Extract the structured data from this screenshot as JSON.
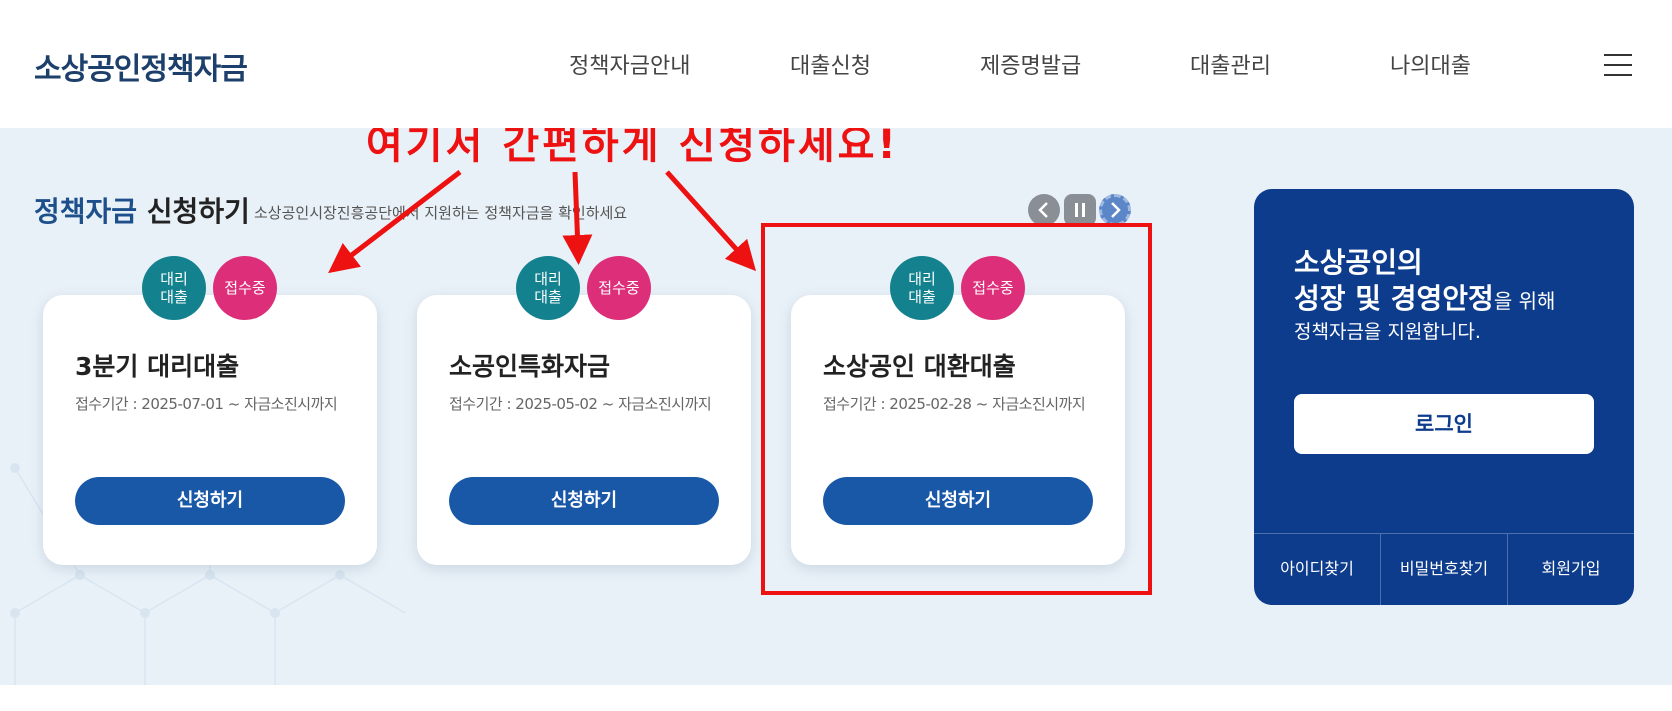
{
  "header": {
    "logo": "소상공인정책자금",
    "nav": [
      "정책자금안내",
      "대출신청",
      "제증명발급",
      "대출관리",
      "나의대출"
    ],
    "menu_icon": "hamburger-icon"
  },
  "promo": {
    "text": "여기서 간편하게 신청하세요!",
    "color": "#ee1111"
  },
  "section": {
    "title_accent": "정책자금",
    "title_rest": " 신청하기",
    "subtitle": "소상공인시장진흥공단에서 지원하는 정책자금을 확인하세요",
    "slider_controls": [
      "prev-icon",
      "pause-icon",
      "next-icon"
    ]
  },
  "cards": [
    {
      "badge_proxy": "대리\n대출",
      "badge_status": "접수중",
      "title": "3분기 대리대출",
      "period": "접수기간 : 2025-07-01 ~ 자금소진시까지",
      "button": "신청하기"
    },
    {
      "badge_proxy": "대리\n대출",
      "badge_status": "접수중",
      "title": "소공인특화자금",
      "period": "접수기간 : 2025-05-02 ~ 자금소진시까지",
      "button": "신청하기"
    },
    {
      "badge_proxy": "대리\n대출",
      "badge_status": "접수중",
      "title": "소상공인 대환대출",
      "period": "접수기간 : 2025-02-28 ~ 자금소진시까지",
      "button": "신청하기"
    }
  ],
  "login_panel": {
    "line1": "소상공인의",
    "line2_bold": "성장 및 경영안정",
    "line2_small": "을 위해",
    "line3": "정책자금을 지원합니다.",
    "login_button": "로그인",
    "links": [
      "아이디찾기",
      "비밀번호찾기",
      "회원가입"
    ]
  },
  "colors": {
    "brand_navy": "#1d3f6b",
    "button_blue": "#1957a7",
    "panel_blue": "#0e3c8c",
    "badge_teal": "#13828e",
    "badge_pink": "#dd2e7a",
    "background": "#e9f1f8"
  }
}
